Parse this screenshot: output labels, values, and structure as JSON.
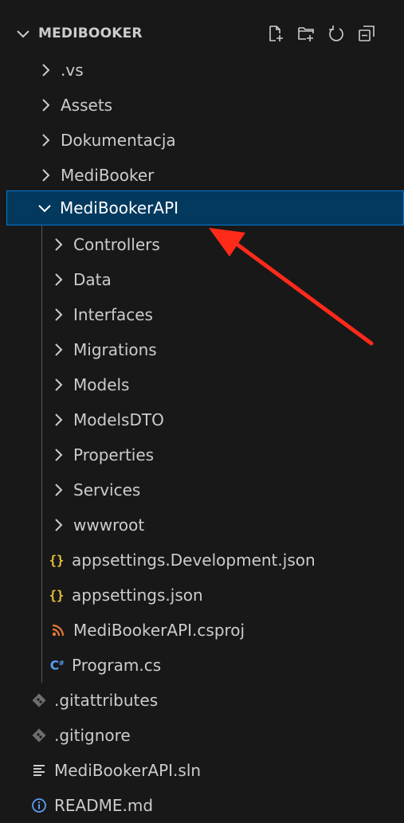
{
  "explorer": {
    "title": "MEDIBOOKER",
    "actions": [
      {
        "icon": "new-file-icon"
      },
      {
        "icon": "new-folder-icon"
      },
      {
        "icon": "refresh-icon"
      },
      {
        "icon": "collapse-all-icon"
      }
    ],
    "items": [
      {
        "label": ".vs",
        "type": "folder",
        "expanded": false,
        "depth": 1
      },
      {
        "label": "Assets",
        "type": "folder",
        "expanded": false,
        "depth": 1
      },
      {
        "label": "Dokumentacja",
        "type": "folder",
        "expanded": false,
        "depth": 1
      },
      {
        "label": "MediBooker",
        "type": "folder",
        "expanded": false,
        "depth": 1
      },
      {
        "label": "MediBookerAPI",
        "type": "folder",
        "expanded": true,
        "selected": true,
        "depth": 1
      },
      {
        "label": "Controllers",
        "type": "folder",
        "expanded": false,
        "depth": 2
      },
      {
        "label": "Data",
        "type": "folder",
        "expanded": false,
        "depth": 2
      },
      {
        "label": "Interfaces",
        "type": "folder",
        "expanded": false,
        "depth": 2
      },
      {
        "label": "Migrations",
        "type": "folder",
        "expanded": false,
        "depth": 2
      },
      {
        "label": "Models",
        "type": "folder",
        "expanded": false,
        "depth": 2
      },
      {
        "label": "ModelsDTO",
        "type": "folder",
        "expanded": false,
        "depth": 2
      },
      {
        "label": "Properties",
        "type": "folder",
        "expanded": false,
        "depth": 2
      },
      {
        "label": "Services",
        "type": "folder",
        "expanded": false,
        "depth": 2
      },
      {
        "label": "wwwroot",
        "type": "folder",
        "expanded": false,
        "depth": 2
      },
      {
        "label": "appsettings.Development.json",
        "type": "json",
        "depth": 2
      },
      {
        "label": "appsettings.json",
        "type": "json",
        "depth": 2
      },
      {
        "label": "MediBookerAPI.csproj",
        "type": "csproj",
        "depth": 2
      },
      {
        "label": "Program.cs",
        "type": "csharp",
        "depth": 2
      },
      {
        "label": ".gitattributes",
        "type": "git",
        "depth": 1
      },
      {
        "label": ".gitignore",
        "type": "git",
        "depth": 1
      },
      {
        "label": "MediBookerAPI.sln",
        "type": "sln",
        "depth": 1
      },
      {
        "label": "README.md",
        "type": "info",
        "depth": 1
      }
    ]
  },
  "colors": {
    "background": "#181818",
    "text": "#cccccc",
    "selection_bg": "#04395e",
    "selection_border": "#0078d4",
    "json_icon": "#e8c33c",
    "csproj_icon": "#e37933",
    "csharp_icon": "#589df6",
    "annotation_arrow": "#ff2a1a"
  }
}
